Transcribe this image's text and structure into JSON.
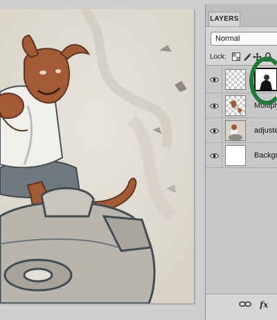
{
  "panel": {
    "tab_label": "LAYERS",
    "blend_mode": "Normal",
    "lock_label": "Lock:",
    "layers": [
      {
        "name": "",
        "visible": true,
        "has_mask": true,
        "thumb": "transparent-checker"
      },
      {
        "name": "Multiply",
        "visible": true,
        "thumb": "red-figure-on-checker"
      },
      {
        "name": "adjusted",
        "visible": true,
        "thumb": "artwork-photo"
      },
      {
        "name": "Backgro",
        "visible": true,
        "thumb": "white"
      }
    ],
    "footer": {
      "link_icon": "link-icon",
      "fx_label": "fx"
    }
  },
  "colors": {
    "highlight_ring": "#1f7a3a",
    "canvas_bg": "#e4dfd5",
    "figure_rust": "#a35a35"
  }
}
